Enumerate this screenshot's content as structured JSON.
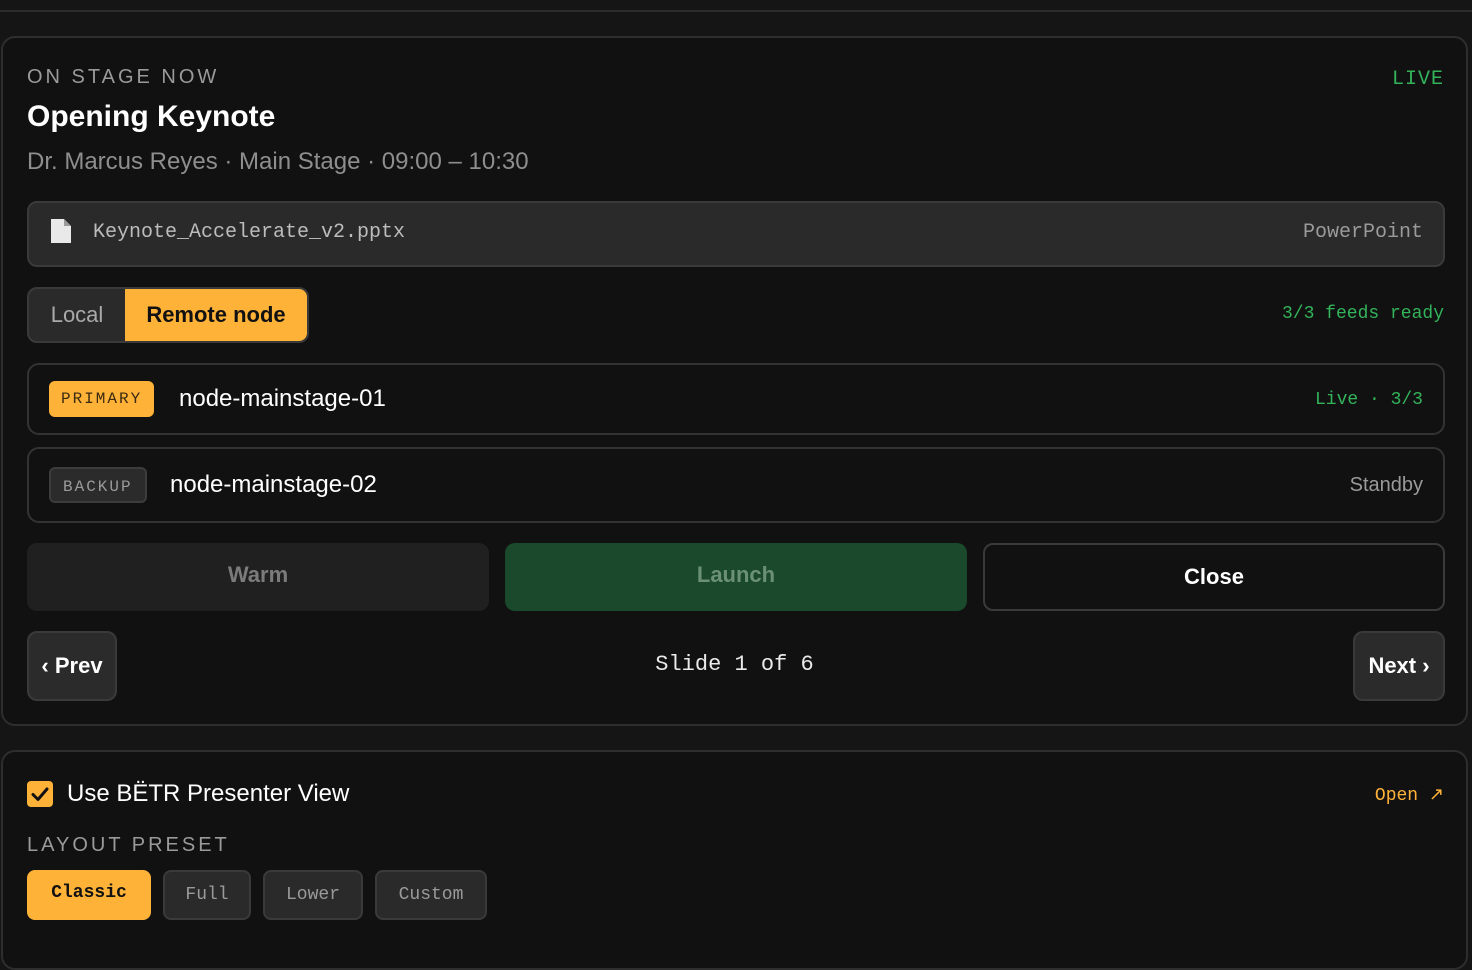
{
  "stage": {
    "eyebrow": "ON STAGE NOW",
    "live_label": "LIVE",
    "title": "Opening Keynote",
    "subtitle": "Dr. Marcus Reyes · Main Stage · 09:00 – 10:30"
  },
  "file": {
    "icon": "document-icon",
    "name": "Keynote_Accelerate_v2.pptx",
    "type": "PowerPoint"
  },
  "mode": {
    "options": [
      "Local",
      "Remote node"
    ],
    "selected": "Remote node",
    "feeds_status": "3/3 feeds ready"
  },
  "nodes": [
    {
      "tag": "PRIMARY",
      "name": "node-mainstage-01",
      "status": "Live · 3/3"
    },
    {
      "tag": "BACKUP",
      "name": "node-mainstage-02",
      "status": "Standby"
    }
  ],
  "actions": {
    "warm": "Warm",
    "launch": "Launch",
    "close": "Close"
  },
  "nav": {
    "prev": "‹ Prev",
    "next": "Next ›",
    "slide_label": "Slide 1 of 6"
  },
  "presenter": {
    "checkbox_label": "Use BËTR Presenter View",
    "checked": true,
    "open_label": "Open ↗"
  },
  "layout": {
    "heading": "LAYOUT PRESET",
    "presets": [
      "Classic",
      "Full",
      "Lower",
      "Custom"
    ],
    "selected": "Classic"
  },
  "colors": {
    "accent": "#ffb238",
    "live_green": "#33b35a",
    "launch_bg": "#1a4a2b"
  }
}
